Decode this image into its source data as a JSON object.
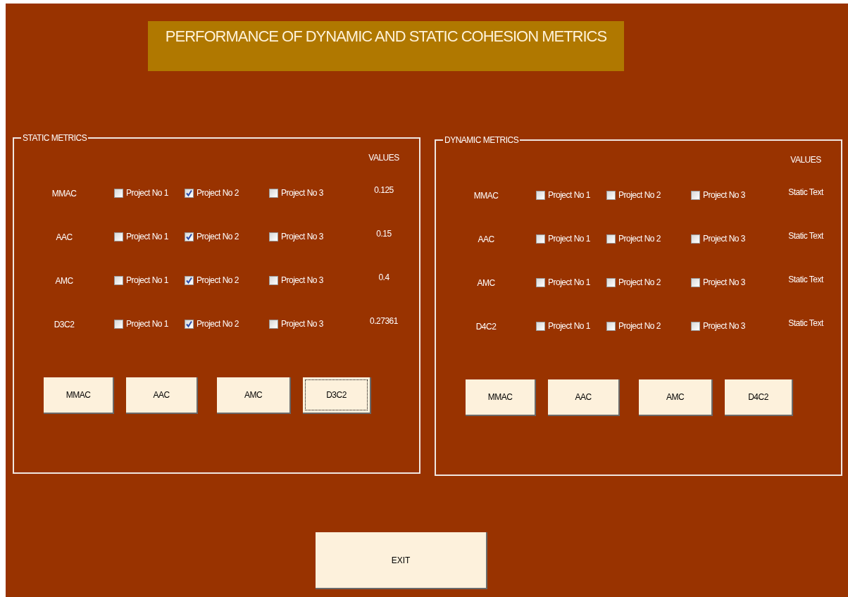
{
  "title": "PERFORMANCE OF DYNAMIC AND STATIC COHESION METRICS",
  "panels": [
    {
      "title": "STATIC METRICS",
      "values_header": "VALUES",
      "rows": [
        {
          "label": "MMAC",
          "projects": [
            {
              "label": "Project No 1",
              "checked": false
            },
            {
              "label": "Project No 2",
              "checked": true
            },
            {
              "label": "Project No 3",
              "checked": false
            }
          ],
          "value": "0.125"
        },
        {
          "label": "AAC",
          "projects": [
            {
              "label": "Project No 1",
              "checked": false
            },
            {
              "label": "Project No 2",
              "checked": true
            },
            {
              "label": "Project No 3",
              "checked": false
            }
          ],
          "value": "0.15"
        },
        {
          "label": "AMC",
          "projects": [
            {
              "label": "Project No 1",
              "checked": false
            },
            {
              "label": "Project No 2",
              "checked": true
            },
            {
              "label": "Project No 3",
              "checked": false
            }
          ],
          "value": "0.4"
        },
        {
          "label": "D3C2",
          "projects": [
            {
              "label": "Project No 1",
              "checked": false
            },
            {
              "label": "Project No 2",
              "checked": true
            },
            {
              "label": "Project No 3",
              "checked": false
            }
          ],
          "value": "0.27361"
        }
      ],
      "buttons": [
        {
          "label": "MMAC",
          "focused": false
        },
        {
          "label": "AAC",
          "focused": false
        },
        {
          "label": "AMC",
          "focused": false
        },
        {
          "label": "D3C2",
          "focused": true
        }
      ]
    },
    {
      "title": "DYNAMIC METRICS",
      "values_header": "VALUES",
      "rows": [
        {
          "label": "MMAC",
          "projects": [
            {
              "label": "Project No 1",
              "checked": false
            },
            {
              "label": "Project No 2",
              "checked": false
            },
            {
              "label": "Project No 3",
              "checked": false
            }
          ],
          "value": "Static Text"
        },
        {
          "label": "AAC",
          "projects": [
            {
              "label": "Project No 1",
              "checked": false
            },
            {
              "label": "Project No 2",
              "checked": false
            },
            {
              "label": "Project No 3",
              "checked": false
            }
          ],
          "value": "Static Text"
        },
        {
          "label": "AMC",
          "projects": [
            {
              "label": "Project No 1",
              "checked": false
            },
            {
              "label": "Project No 2",
              "checked": false
            },
            {
              "label": "Project No 3",
              "checked": false
            }
          ],
          "value": "Static Text"
        },
        {
          "label": "D4C2",
          "projects": [
            {
              "label": "Project No 1",
              "checked": false
            },
            {
              "label": "Project No 2",
              "checked": false
            },
            {
              "label": "Project No 3",
              "checked": false
            }
          ],
          "value": "Static Text"
        }
      ],
      "buttons": [
        {
          "label": "MMAC",
          "focused": false
        },
        {
          "label": "AAC",
          "focused": false
        },
        {
          "label": "AMC",
          "focused": false
        },
        {
          "label": "D4C2",
          "focused": false
        }
      ]
    }
  ],
  "exit_button": "EXIT"
}
